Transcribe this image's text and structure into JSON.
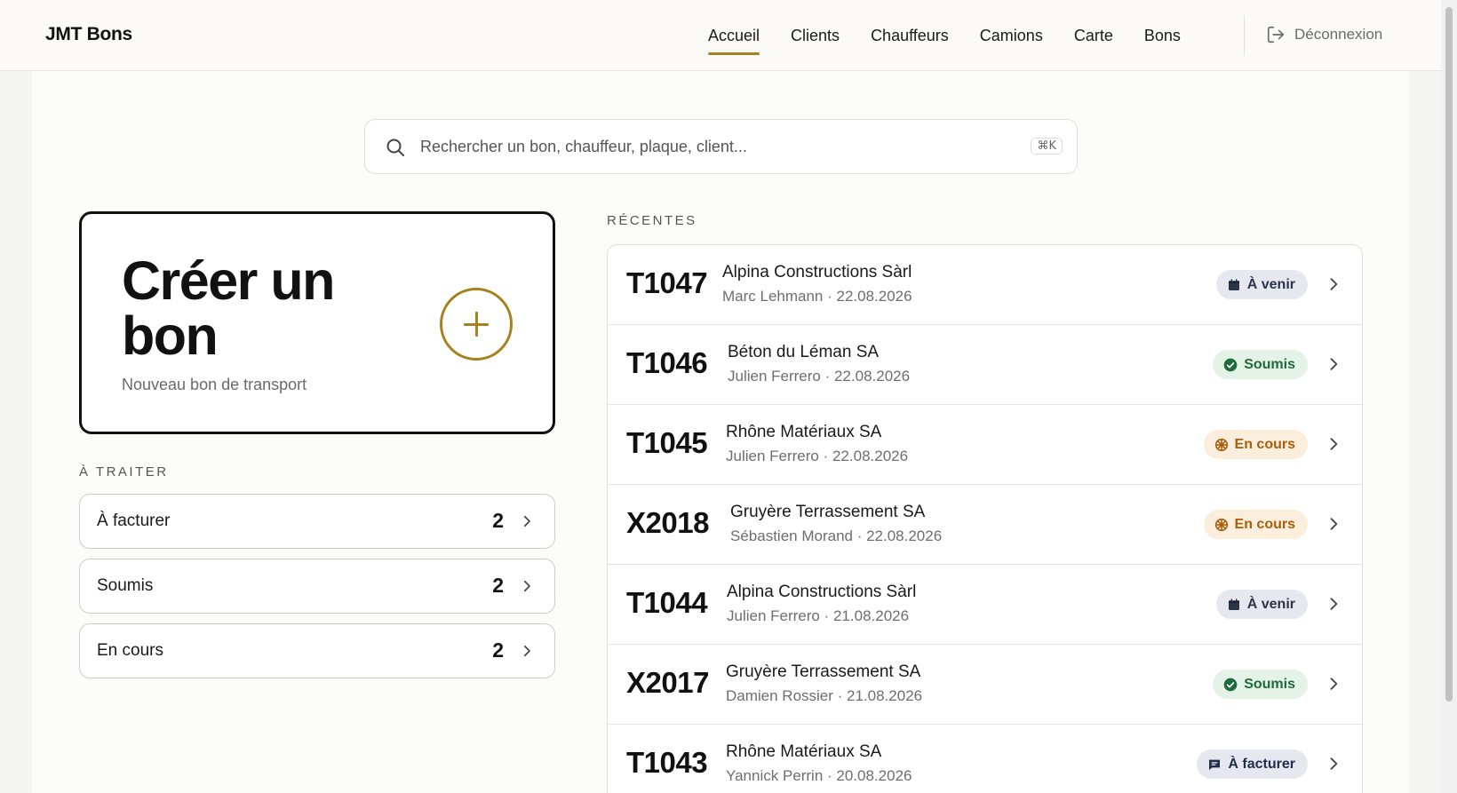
{
  "app": {
    "brand": "JMT Bons"
  },
  "nav": {
    "items": [
      {
        "label": "Accueil",
        "active": true
      },
      {
        "label": "Clients",
        "active": false
      },
      {
        "label": "Chauffeurs",
        "active": false
      },
      {
        "label": "Camions",
        "active": false
      },
      {
        "label": "Carte",
        "active": false
      },
      {
        "label": "Bons",
        "active": false
      }
    ],
    "logout_label": "Déconnexion"
  },
  "search": {
    "placeholder": "Rechercher un bon, chauffeur, plaque, client...",
    "shortcut": "⌘K"
  },
  "create_card": {
    "title": "Créer un bon",
    "subtitle": "Nouveau bon de transport"
  },
  "todo": {
    "section_label": "À TRAITER",
    "items": [
      {
        "label": "À facturer",
        "count": "2"
      },
      {
        "label": "Soumis",
        "count": "2"
      },
      {
        "label": "En cours",
        "count": "2"
      }
    ]
  },
  "recent": {
    "section_label": "RÉCENTES",
    "items": [
      {
        "id": "T1047",
        "client": "Alpina Constructions Sàrl",
        "meta": "Marc Lehmann · 22.08.2026",
        "status": "À venir",
        "status_type": "venir",
        "status_icon": "calendar-icon"
      },
      {
        "id": "T1046",
        "client": "Béton du Léman SA",
        "meta": "Julien Ferrero · 22.08.2026",
        "status": "Soumis",
        "status_type": "soumis",
        "status_icon": "check-circle-icon"
      },
      {
        "id": "T1045",
        "client": "Rhône Matériaux SA",
        "meta": "Julien Ferrero · 22.08.2026",
        "status": "En cours",
        "status_type": "cours",
        "status_icon": "wheel-icon"
      },
      {
        "id": "X2018",
        "client": "Gruyère Terrassement SA",
        "meta": "Sébastien Morand · 22.08.2026",
        "status": "En cours",
        "status_type": "cours",
        "status_icon": "wheel-icon"
      },
      {
        "id": "T1044",
        "client": "Alpina Constructions Sàrl",
        "meta": "Julien Ferrero · 21.08.2026",
        "status": "À venir",
        "status_type": "venir",
        "status_icon": "calendar-icon"
      },
      {
        "id": "X2017",
        "client": "Gruyère Terrassement SA",
        "meta": "Damien Rossier · 21.08.2026",
        "status": "Soumis",
        "status_type": "soumis",
        "status_icon": "check-circle-icon"
      },
      {
        "id": "T1043",
        "client": "Rhône Matériaux SA",
        "meta": "Yannick Perrin · 20.08.2026",
        "status": "À facturer",
        "status_type": "facturer",
        "status_icon": "invoice-icon"
      }
    ]
  },
  "colors": {
    "accent": "#a8811f",
    "status_venir": "#2b3548",
    "status_soumis": "#1f6b3a",
    "status_cours": "#a95f0a"
  }
}
